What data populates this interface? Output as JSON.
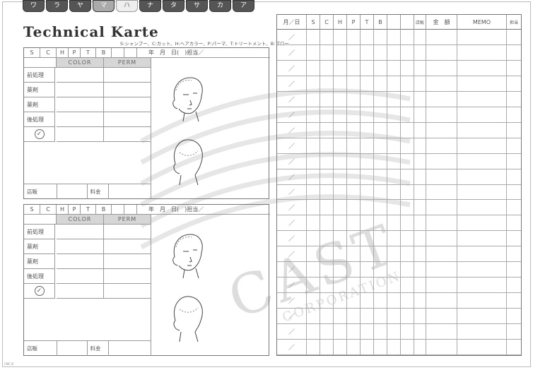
{
  "tabs": [
    "ワ",
    "ラ",
    "ヤ",
    "マ",
    "ハ",
    "ナ",
    "タ",
    "サ",
    "カ",
    "ア"
  ],
  "title": "Technical Karte",
  "legend": "S:シャンプー、C:カット、H:ヘアカラー、P:パーマ、T:トリートメント、B:ブロー",
  "card": {
    "header_cols": [
      "S",
      "C",
      "H",
      "P",
      "T",
      "B"
    ],
    "date_line": "年　月　日(　)担当／",
    "sub_cols": [
      "COLOR",
      "PERM"
    ],
    "rows": [
      "前処理",
      "薬剤",
      "薬剤",
      "後処理"
    ],
    "check_symbol": "✓",
    "store_label": "店販",
    "fee_label": "料金"
  },
  "table": {
    "headers": [
      "月／日",
      "S",
      "C",
      "H",
      "P",
      "T",
      "B",
      "",
      "",
      "店販",
      "金　額",
      "MEMO",
      "担当"
    ],
    "slash": "／",
    "row_count": 21
  },
  "watermark": {
    "main": "CAST",
    "sub": "CORPORATION"
  },
  "footer_code": "CMC B"
}
